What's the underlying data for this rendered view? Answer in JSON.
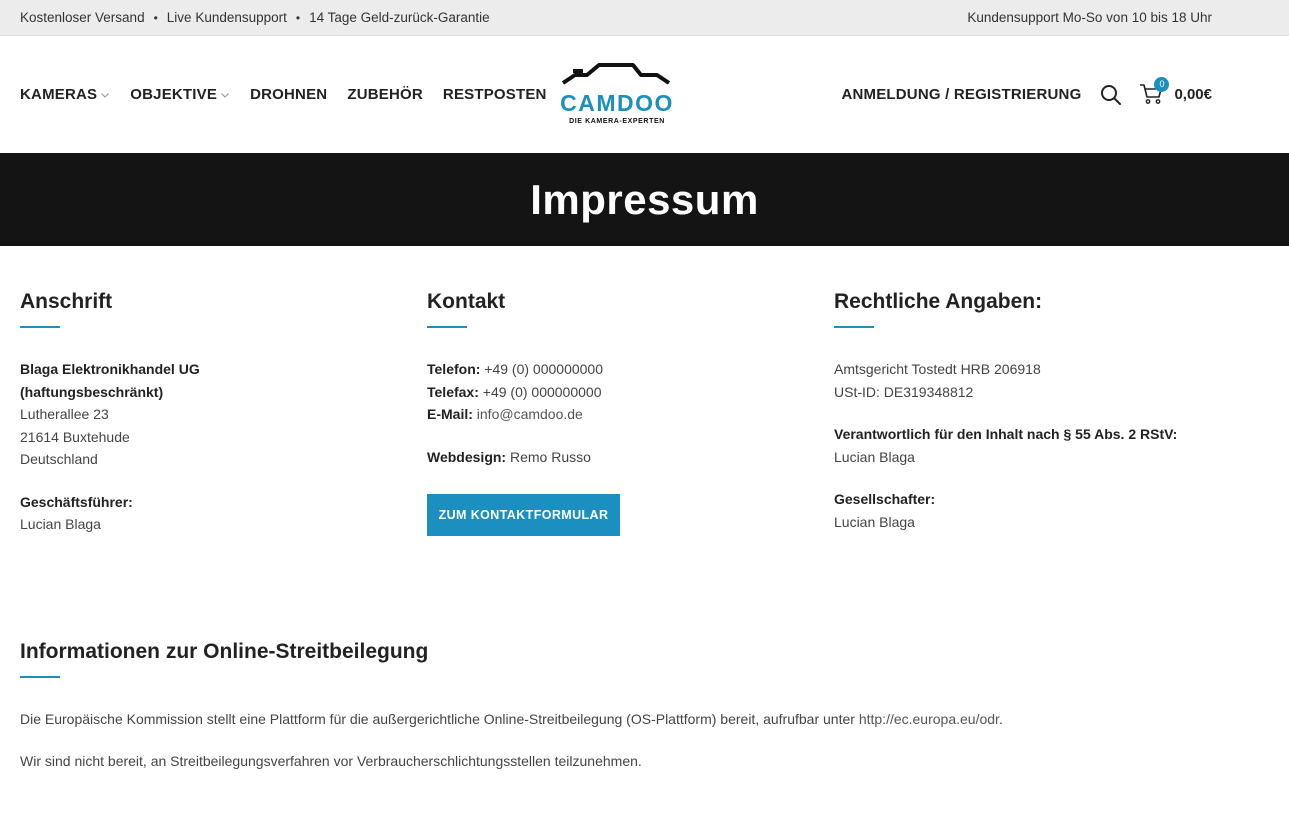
{
  "topbar": {
    "left_items": [
      "Kostenloser Versand",
      "Live Kundensupport",
      "14 Tage Geld-zurück-Garantie"
    ],
    "separator": "•",
    "right_text": "Kundensupport Mo-So von 10 bis 18 Uhr"
  },
  "header": {
    "nav": [
      {
        "label": "KAMERAS",
        "has_dropdown": true
      },
      {
        "label": "OBJEKTIVE",
        "has_dropdown": true
      },
      {
        "label": "DROHNEN",
        "has_dropdown": false
      },
      {
        "label": "ZUBEHÖR",
        "has_dropdown": false
      },
      {
        "label": "RESTPOSTEN",
        "has_dropdown": false
      }
    ],
    "logo": {
      "name": "CAMDOO",
      "tagline": "DIE KAMERA-EXPERTEN",
      "color": "#1b8fbf"
    },
    "login_label": "ANMELDUNG / REGISTRIERUNG",
    "cart_count": "0",
    "cart_total": "0,00€"
  },
  "hero": {
    "title": "Impressum"
  },
  "address": {
    "heading": "Anschrift",
    "company_line1": "Blaga Elektronikhandel UG",
    "company_line2": "(haftungsbeschränkt)",
    "street": "Lutherallee 23",
    "city": "21614 Buxtehude",
    "country": "Deutschland",
    "ceo_label": "Geschäftsführer:",
    "ceo_name": "Lucian Blaga"
  },
  "contact": {
    "heading": "Kontakt",
    "phone_label": "Telefon:",
    "phone": " +49 (0) 000000000",
    "fax_label": "Telefax:",
    "fax": " +49 (0) 000000000",
    "email_label": "E-Mail:",
    "email": "info@camdoo.de",
    "webdesign_label": "Webdesign:",
    "webdesign": " Remo Russo",
    "button_label": "ZUM KONTAKTFORMULAR"
  },
  "legal": {
    "heading": "Rechtliche Angaben:",
    "court": "Amtsgericht Tostedt HRB 206918",
    "vat": "USt-ID: DE319348812",
    "responsible_label": "Verantwortlich für den Inhalt nach § 55 Abs. 2 RStV:",
    "responsible_name": "Lucian Blaga",
    "shareholder_label": "Gesellschafter:",
    "shareholder_name": "Lucian Blaga"
  },
  "ods": {
    "heading": "Informationen zur Online-Streitbeilegung",
    "para1_text": "Die Europäische Kommission stellt eine Plattform für die außergerichtliche Online-Streitbeilegung (OS-Plattform) bereit, aufrufbar unter ",
    "para1_link": "http://ec.europa.eu/odr",
    "para1_end": ".",
    "para2": "Wir sind nicht bereit, an Streitbeilegungsverfahren vor Verbraucherschlichtungsstellen teilzunehmen."
  },
  "colors": {
    "accent": "#1b8fbf",
    "hero_bg": "#141414",
    "topbar_bg": "#ececec"
  }
}
